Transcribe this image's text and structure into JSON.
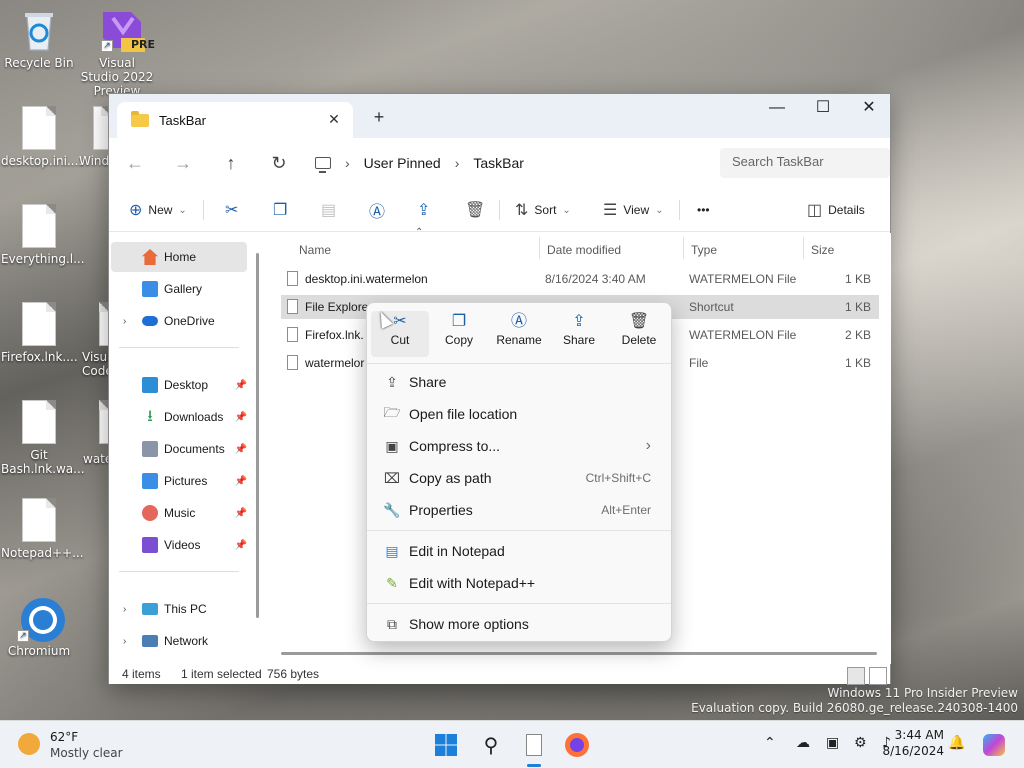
{
  "desktop": {
    "icons": [
      {
        "label": "Recycle Bin"
      },
      {
        "label": "Visual Studio 2022 Preview",
        "badge": "PRE"
      },
      {
        "label": "desktop.ini...."
      },
      {
        "label": "Wind"
      },
      {
        "label": "Everything.l..."
      },
      {
        "label": "Firefox.lnk...."
      },
      {
        "label": "Visua Code"
      },
      {
        "label": "Git Bash.lnk.wa..."
      },
      {
        "label": "wate"
      },
      {
        "label": "Notepad++..."
      },
      {
        "label": "Chromium"
      }
    ]
  },
  "window": {
    "tab_title": "TaskBar",
    "tab_close": "✕",
    "new_tab": "+",
    "controls": {
      "minimize": "—",
      "maximize": "☐",
      "close": "✕"
    }
  },
  "address": {
    "crumbs": [
      "User Pinned",
      "TaskBar"
    ],
    "search_placeholder": "Search TaskBar"
  },
  "commands": {
    "new": "New",
    "sort": "Sort",
    "view": "View",
    "more": "•••",
    "details": "Details"
  },
  "nav": {
    "items": [
      {
        "label": "Home"
      },
      {
        "label": "Gallery"
      },
      {
        "label": "OneDrive"
      },
      {
        "label": "Desktop"
      },
      {
        "label": "Downloads"
      },
      {
        "label": "Documents"
      },
      {
        "label": "Pictures"
      },
      {
        "label": "Music"
      },
      {
        "label": "Videos"
      },
      {
        "label": "This PC"
      },
      {
        "label": "Network"
      }
    ]
  },
  "files": {
    "columns": [
      "Name",
      "Date modified",
      "Type",
      "Size"
    ],
    "rows": [
      {
        "name": "desktop.ini.watermelon",
        "date": "8/16/2024 3:40 AM",
        "type": "WATERMELON File",
        "size": "1 KB"
      },
      {
        "name": "File Explore",
        "date": "",
        "type": "Shortcut",
        "size": "1 KB"
      },
      {
        "name": "Firefox.lnk.",
        "date": "",
        "type": "WATERMELON File",
        "size": "2 KB"
      },
      {
        "name": "watermelor",
        "date": "",
        "type": "File",
        "size": "1 KB"
      }
    ]
  },
  "status": {
    "count": "4 items",
    "selection": "1 item selected",
    "size": "756 bytes"
  },
  "context_menu": {
    "quick_actions": [
      "Cut",
      "Copy",
      "Rename",
      "Share",
      "Delete"
    ],
    "items": [
      {
        "label": "Share",
        "accel": ""
      },
      {
        "label": "Open file location",
        "accel": ""
      },
      {
        "label": "Compress to...",
        "accel": "›"
      },
      {
        "label": "Copy as path",
        "accel": "Ctrl+Shift+C"
      },
      {
        "label": "Properties",
        "accel": "Alt+Enter"
      },
      {
        "label": "Edit in Notepad",
        "accel": ""
      },
      {
        "label": "Edit with Notepad++",
        "accel": ""
      },
      {
        "label": "Show more options",
        "accel": ""
      }
    ]
  },
  "watermark": {
    "line1": "Windows 11 Pro Insider Preview",
    "line2": "Evaluation copy. Build 26080.ge_release.240308-1400"
  },
  "taskbar": {
    "weather_temp": "62°F",
    "weather_desc": "Mostly clear",
    "time": "3:44 AM",
    "date": "8/16/2024"
  },
  "colors": {
    "accent": "#1f5fa8",
    "selection": "#dcdcdc",
    "folder": "#f7c948"
  }
}
